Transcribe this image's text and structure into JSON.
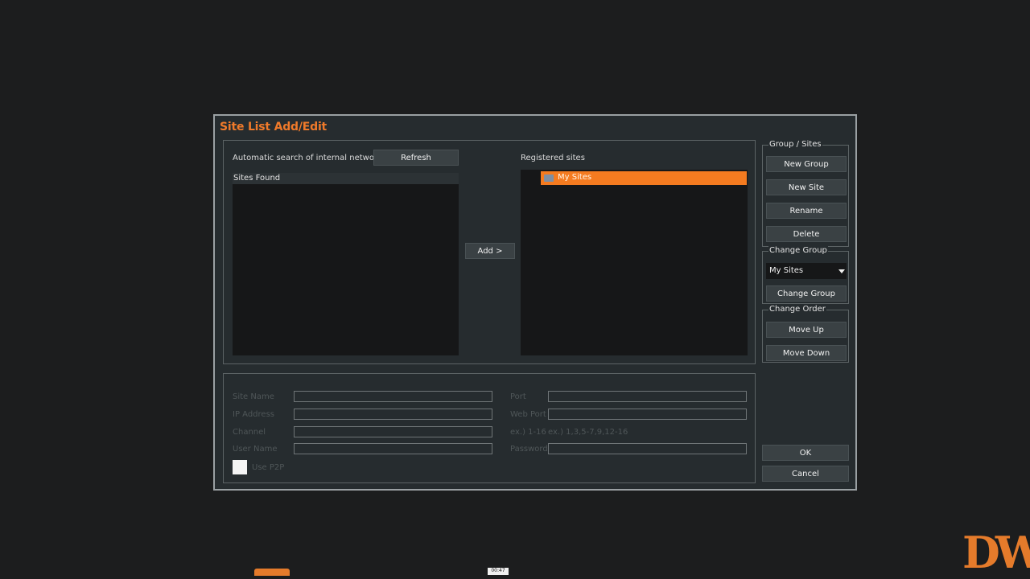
{
  "dialog": {
    "title": "Site List Add/Edit",
    "search_label": "Automatic search of internal network",
    "refresh_label": "Refresh",
    "sites_found_label": "Sites Found",
    "add_label": "Add >",
    "registered_label": "Registered sites",
    "registered_items": [
      {
        "label": "My Sites",
        "icon": "folder-icon",
        "selected": true
      }
    ]
  },
  "group_sites": {
    "label": "Group / Sites",
    "buttons": [
      "New Group",
      "New Site",
      "Rename",
      "Delete"
    ]
  },
  "change_group": {
    "label": "Change Group",
    "selected": "My Sites",
    "button": "Change Group"
  },
  "change_order": {
    "label": "Change Order",
    "buttons": [
      "Move Up",
      "Move Down"
    ]
  },
  "form": {
    "site_name": "Site Name",
    "ip_address": "IP Address",
    "channel": "Channel",
    "user_name": "User Name",
    "port": "Port",
    "web_port": "Web Port",
    "channel_example_1": "ex.) 1-16",
    "channel_example_2": "ex.) 1,3,5-7,9,12-16",
    "password": "Password",
    "use_p2p": "Use P2P"
  },
  "actions": {
    "ok": "OK",
    "cancel": "Cancel"
  },
  "overlay": {
    "timestamp": "00:47",
    "logo": "DW"
  },
  "colors": {
    "accent": "#f07a2a",
    "selection": "#f47b20",
    "background": "#1c1d1e",
    "dialog": "#262c2f"
  }
}
